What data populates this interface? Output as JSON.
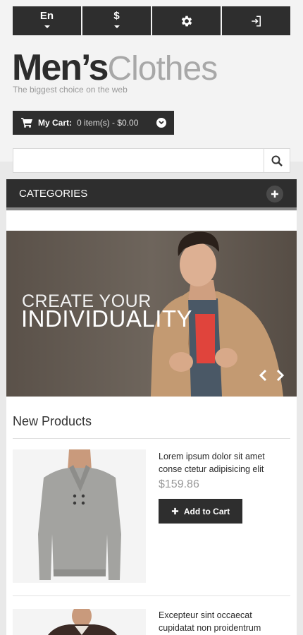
{
  "topbar": {
    "language": "En",
    "currency": "$",
    "settings_icon": "gear-icon",
    "login_icon": "sign-in-icon"
  },
  "brand": {
    "name_part1": "Men’s",
    "name_part2": "Clothes",
    "tagline": "The biggest choice on the web"
  },
  "cart": {
    "label": "My Cart:",
    "summary": "0 item(s) - $0.00"
  },
  "search": {
    "value": "",
    "placeholder": ""
  },
  "categories": {
    "label": "CATEGORIES"
  },
  "banner": {
    "headline_line1": "CREATE YOUR",
    "headline_line2": "INDIVIDUALITY"
  },
  "new_products": {
    "title": "New Products",
    "items": [
      {
        "name": "Lorem ipsum dolor sit amet conse ctetur adipisicing elit",
        "price": "$159.86",
        "button": "Add to Cart"
      },
      {
        "name": "Excepteur sint occaecat cupidatat non proidentrum"
      }
    ]
  },
  "colors": {
    "dark": "#2e2e2e",
    "muted": "#999999",
    "page_bg": "#f3f3f3"
  }
}
